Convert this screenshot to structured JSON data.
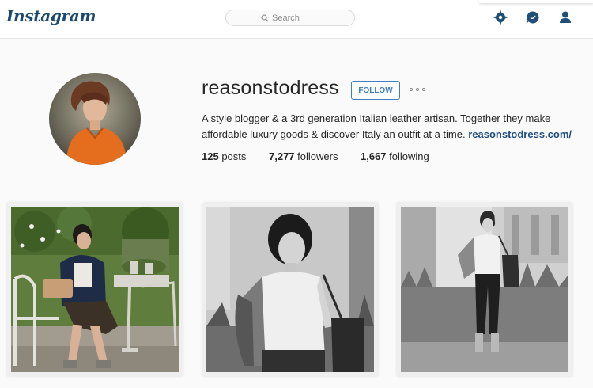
{
  "topbar": {
    "logo": "Instagram",
    "search_placeholder": "Search",
    "icons": [
      "explore-icon",
      "activity-icon",
      "profile-icon"
    ]
  },
  "profile": {
    "username": "reasonstodress",
    "follow_label": "FOLLOW",
    "bio_text": "A style blogger & a 3rd generation Italian leather artisan. Together they make affordable luxury goods & discover Italy an outfit at a time.",
    "website": "reasonstodress.com/",
    "stats": {
      "posts_count": "125",
      "posts_label": "posts",
      "followers_count": "7,277",
      "followers_label": "followers",
      "following_count": "1,667",
      "following_label": "following"
    }
  },
  "posts": [
    {
      "style": "color",
      "subject": "woman seated on bench in garden"
    },
    {
      "style": "black-and-white",
      "subject": "woman with jacket and tote bag"
    },
    {
      "style": "black-and-white",
      "subject": "woman standing in tall grass"
    }
  ],
  "colors": {
    "accent": "#3f7fc1",
    "link": "#1d4f80",
    "logo": "#1c4a6e",
    "nav_icons": "#1f4f78"
  }
}
